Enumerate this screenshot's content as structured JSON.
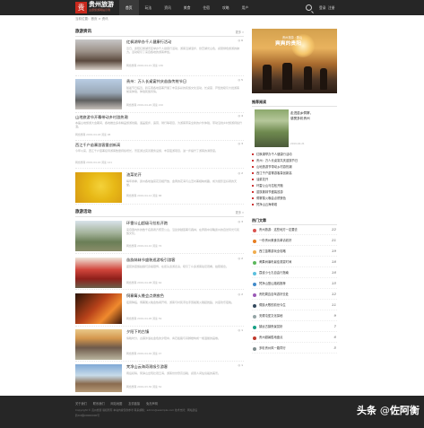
{
  "header": {
    "logo_char": "贵",
    "site_title": "贵州旅游",
    "site_sub": "主题旅游网站示例",
    "nav": [
      "首页",
      "玩法",
      "资讯",
      "美食",
      "住宿",
      "攻略",
      "用户"
    ],
    "right_links": [
      "登录",
      "注册"
    ]
  },
  "breadcrumb": "当前位置：首页 > 资讯",
  "section1": {
    "title": "旅游资讯",
    "more": "更多 »",
    "articles": [
      {
        "title": "红枫湖举办千人健康行活动",
        "summary": "近日，贵阳红枫湖景区举办千人健康行活动，游客沿湖漫步，欣赏湖光山色，感受绿色旅游的魅力。活动吸引了来自各地的游客参加。",
        "meta": "网络整理  2019-04-21  阅读 136",
        "badge": "◎ 6"
      },
      {
        "title": "贵州：万人长桌宴共庆苗族传统节日",
        "summary": "随着节日临近，黔东南各地苗寨开展了丰富多彩的民族文化活动，长桌宴、芦笙舞吸引大批游客前来体验，体验民族风情。",
        "meta": "网络整理  2019-04-20  阅读 210",
        "badge": "◎ 5"
      }
    ],
    "text_articles": [
      {
        "title": "山地旅游节开幕带动乡村游热潮",
        "summary": "本届山地旅游大会期间，各地推出多条精品旅游线路，涵盖徒步、露营、骑行等项目，为游客带来全新的户外体验，带动沿线乡村旅游持续升温。",
        "meta": "网络整理  2019-04-18  阅读 98",
        "badge": "◎ 4"
      },
      {
        "title": "西江千户苗寨游客量创新高",
        "summary": "今年以来，西江千户苗寨接待游客数量持续增长，景区通过完善服务设施、丰富夜游项目，进一步提升了游客的满意度。",
        "meta": "网络整理  2019-04-16  阅读 121",
        "badge": "◎ 3"
      }
    ],
    "last_article": {
      "title": "油菜花开",
      "summary": "每年春季，贵州各地油菜花竞相开放，金黄的花海与山峦村寨相映成趣，成为摄影爱好者的天堂。",
      "meta": "网络整理  2019-04-12  阅读 88",
      "badge": "◎ 2"
    }
  },
  "section2": {
    "title": "旅游活动",
    "more": "更多 »",
    "articles": [
      {
        "title": "环雷公山超级马拉松开跑",
        "summary": "来自国内外的数千名跑者齐聚雷公山，沿途穿越苗寨与森林，在奔跑中领略贵州的自然风光与民族文化。",
        "meta": "网络整理  2019-04-10  阅读 76",
        "badge": "◎ 3"
      },
      {
        "title": "苗族姊妹节盛装巡游吸引游客",
        "summary": "盛装的苗族姑娘们身着银饰，在街头巡游表演，吸引了众多游客驻足观看，拍照留念。",
        "meta": "网络整理  2019-04-08  阅读 64",
        "badge": "◎ 2"
      },
      {
        "title": "侗寨篝火晚会点燃夜色",
        "summary": "夜幕降临，侗寨篝火晚会热闹开场，游客与村民手拉手围着篝火跳起舞蹈，共度欢乐夜晚。",
        "meta": "网络整理  2019-04-05  阅读 59",
        "badge": "◎ 2"
      },
      {
        "title": "夕阳下的古镇",
        "summary": "傍晚时分，古镇沐浴在金色的夕阳中，青石板路与吊脚楼构成一幅温馨的画卷。",
        "meta": "网络整理  2019-04-02  阅读 47",
        "badge": "◎ 1"
      },
      {
        "title": "梵净山云海奇观吸引游客",
        "summary": "雨后初晴，梵净山出现壮观云海，游客纷纷登高远眺，感受人间仙境般的美景。",
        "meta": "网络整理  2019-03-30  阅读 52",
        "badge": "◎ 1"
      }
    ]
  },
  "sidebar": {
    "hero_text_small": "贵州旅游 · 登山",
    "hero_text_big": "爽爽的贵阳",
    "featured_head": "推荐阅读",
    "featured_title_1": "走进苗乡侗寨，",
    "featured_title_2": "感受多彩贵州",
    "featured_meta": "2019-04-21",
    "list": [
      "红枫湖举办千人健康行活动",
      "贵州：万人长桌宴共庆苗族节日",
      "山地旅游节带动乡村游热潮",
      "西江千户苗寨游客量创新高",
      "油菜花开",
      "环雷公山马拉松开跑",
      "苗族姊妹节盛装巡游",
      "侗寨篝火晚会点燃夜色",
      "梵净山云海奇观"
    ],
    "hot_head": "热门文章",
    "hot": [
      {
        "text": "贵州旅游：这些地方一定要去",
        "num": "22",
        "color": "#d9534f"
      },
      {
        "text": "一份贵州美食清单请收好",
        "num": "21",
        "color": "#e67e22"
      },
      {
        "text": "西江苗寨游玩全攻略",
        "num": "19",
        "color": "#f0ad4e"
      },
      {
        "text": "黄果树瀑布最佳观赏时间",
        "num": "18",
        "color": "#5cb85c"
      },
      {
        "text": "荔波小七孔自由行指南",
        "num": "16",
        "color": "#5bc0de"
      },
      {
        "text": "梵净山登山路线推荐",
        "num": "15",
        "color": "#428bca"
      },
      {
        "text": "贵阳周边自驾游好去处",
        "num": "12",
        "color": "#9b59b6"
      },
      {
        "text": "侗族大歌的前世今生",
        "num": "11",
        "color": "#34495e"
      },
      {
        "text": "安顺屯堡文化探秘",
        "num": "9",
        "color": "#95a5a6"
      },
      {
        "text": "镇远古镇夜景赏析",
        "num": "7",
        "color": "#16a085"
      },
      {
        "text": "贵州避暑胜地盘点",
        "num": "6",
        "color": "#c0392b"
      },
      {
        "text": "多彩贵州风一路同行",
        "num": "5",
        "color": "#7f8c8d"
      }
    ]
  },
  "footer": {
    "links": [
      "关于我们",
      "联系我们",
      "网站地图",
      "友情链接",
      "免责声明"
    ],
    "copy1": "Copyright © 贵州旅游 版权所有  本站内容仅供参考  联系邮箱：admin@example.com  技术支持：网站建设",
    "copy2": "黔ICP备00000000号"
  },
  "watermark": {
    "prefix": "头条",
    "at": "@",
    "name": "佐阿衡"
  }
}
